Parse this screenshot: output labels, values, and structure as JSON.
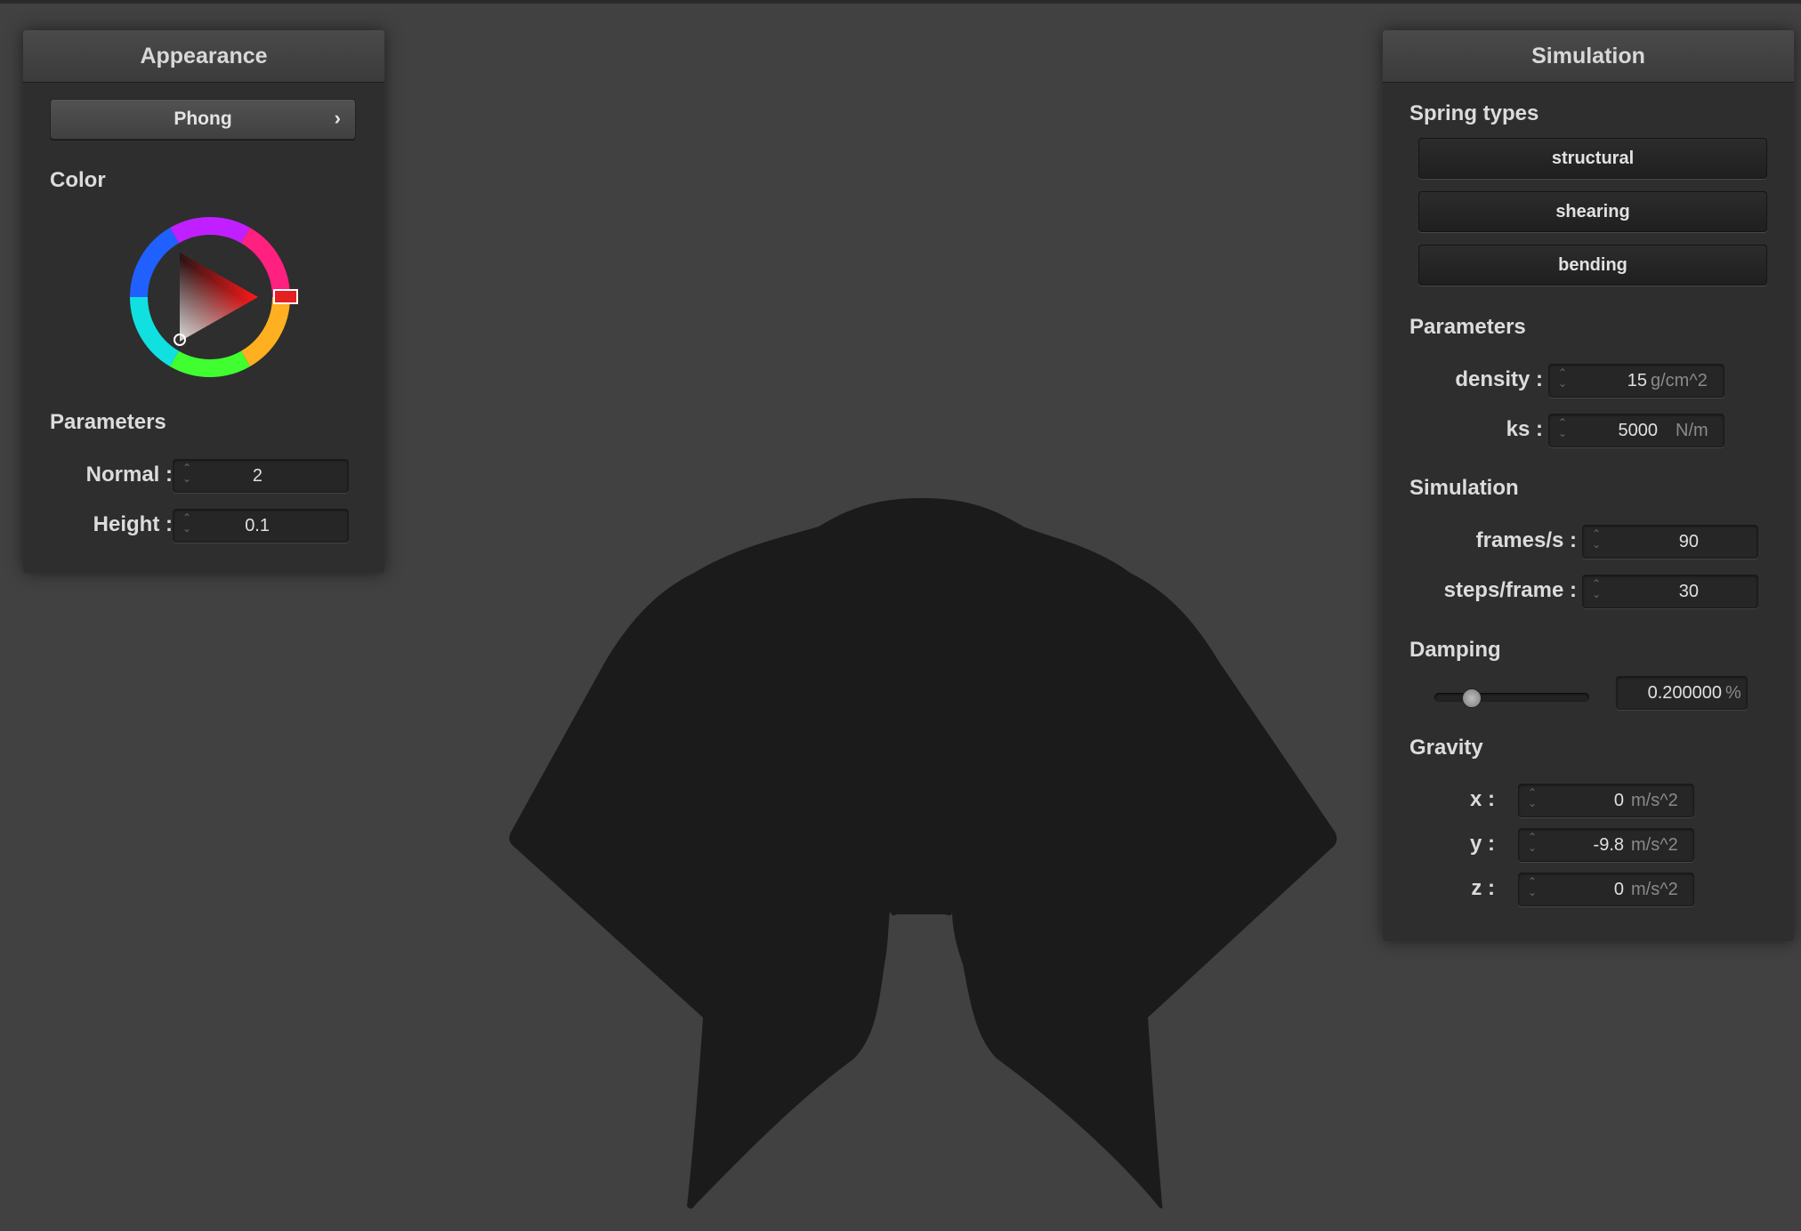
{
  "colors": {
    "background": "#414141",
    "panel": "#2e2e2e",
    "cloth": "#1b1b1b",
    "selected_color": "#e52020"
  },
  "appearance": {
    "title": "Appearance",
    "shader_label": "Phong",
    "shader_chevron": "›",
    "color_label": "Color",
    "params_label": "Parameters",
    "normal_label": "Normal :",
    "normal_value": "2",
    "height_label": "Height :",
    "height_value": "0.1"
  },
  "simulation": {
    "title": "Simulation",
    "spring_types_label": "Spring types",
    "springs": [
      "structural",
      "shearing",
      "bending"
    ],
    "params_label": "Parameters",
    "density_label": "density :",
    "density_value": "15",
    "density_unit": "g/cm^2",
    "ks_label": "ks :",
    "ks_value": "5000",
    "ks_unit": "N/m",
    "sim_label": "Simulation",
    "fps_label": "frames/s :",
    "fps_value": "90",
    "steps_label": "steps/frame :",
    "steps_value": "30",
    "damping_label": "Damping",
    "damping_value": "0.200000",
    "damping_unit": "%",
    "damping_fraction": 0.2,
    "gravity_label": "Gravity",
    "gx_label": "x :",
    "gx_value": "0",
    "gy_label": "y :",
    "gy_value": "-9.8",
    "gz_label": "z :",
    "gz_value": "0",
    "g_unit": "m/s^2"
  }
}
